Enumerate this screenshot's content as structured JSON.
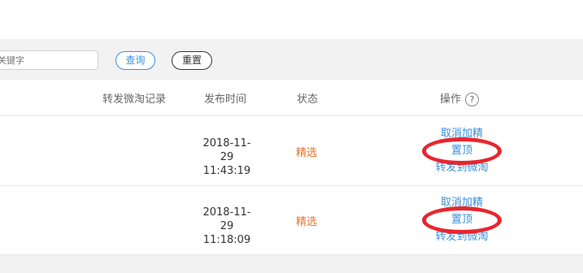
{
  "filter": {
    "search_placeholder": "关键字",
    "query_label": "查询",
    "reset_label": "重置"
  },
  "table": {
    "headers": {
      "truncated": "(",
      "repost_record": "转发微淘记录",
      "publish_time": "发布时间",
      "status": "状态",
      "operation": "操作",
      "help_glyph": "?"
    },
    "rows": [
      {
        "date": "2018-11-29",
        "time": "11:43:19",
        "status": "精选",
        "ops": {
          "cancel_featured": "取消加精",
          "pin_top": "置顶",
          "repost": "转发到微淘"
        }
      },
      {
        "date": "2018-11-29",
        "time": "11:18:09",
        "status": "精选",
        "ops": {
          "cancel_featured": "取消加精",
          "pin_top": "置顶",
          "repost": "转发到微淘"
        }
      }
    ]
  },
  "colors": {
    "accent_blue": "#3b8fd9",
    "status_orange": "#e8722a",
    "highlight_red": "#e8262e",
    "filter_bg": "#f2f2f2"
  }
}
